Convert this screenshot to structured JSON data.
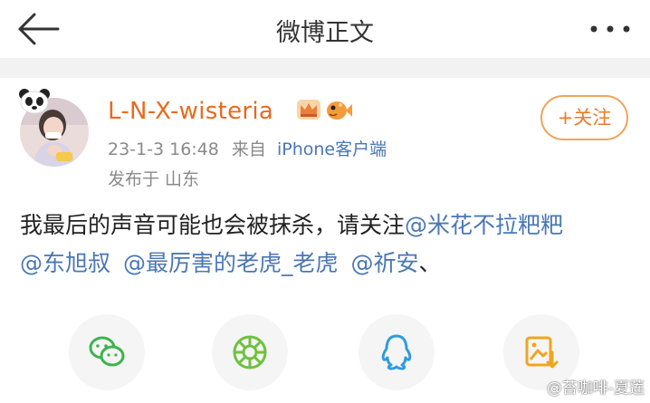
{
  "header": {
    "title": "微博正文",
    "back_icon": "back-arrow-icon",
    "more_icon": "more-dots-icon"
  },
  "post": {
    "author": "L-N-X-wisteria",
    "badges": [
      "crown-icon",
      "fish-icon"
    ],
    "date": "23-1-3 16:48",
    "source_prefix": "来自",
    "client": "iPhone客户端",
    "location": "发布于 山东",
    "follow_label": "+关注",
    "text_before": "我最后的声音可能也会被抹杀，请关注",
    "mentions": [
      "@米花不拉粑粑",
      "@东旭叔",
      "@最厉害的老虎_老虎",
      "@祈安"
    ],
    "text_after": "、"
  },
  "share": {
    "buttons": [
      {
        "name": "wechat-icon",
        "color": "#3db34f"
      },
      {
        "name": "moments-icon",
        "color": "#6fc13f"
      },
      {
        "name": "qq-icon",
        "color": "#2d9be0"
      },
      {
        "name": "save-image-icon",
        "color": "#f0a51f"
      }
    ]
  },
  "watermark": "@苔咖啡-夏莲",
  "colors": {
    "accent_orange": "#e86a1c",
    "link_blue": "#4a77b5",
    "meta_gray": "#8a8a8a"
  }
}
